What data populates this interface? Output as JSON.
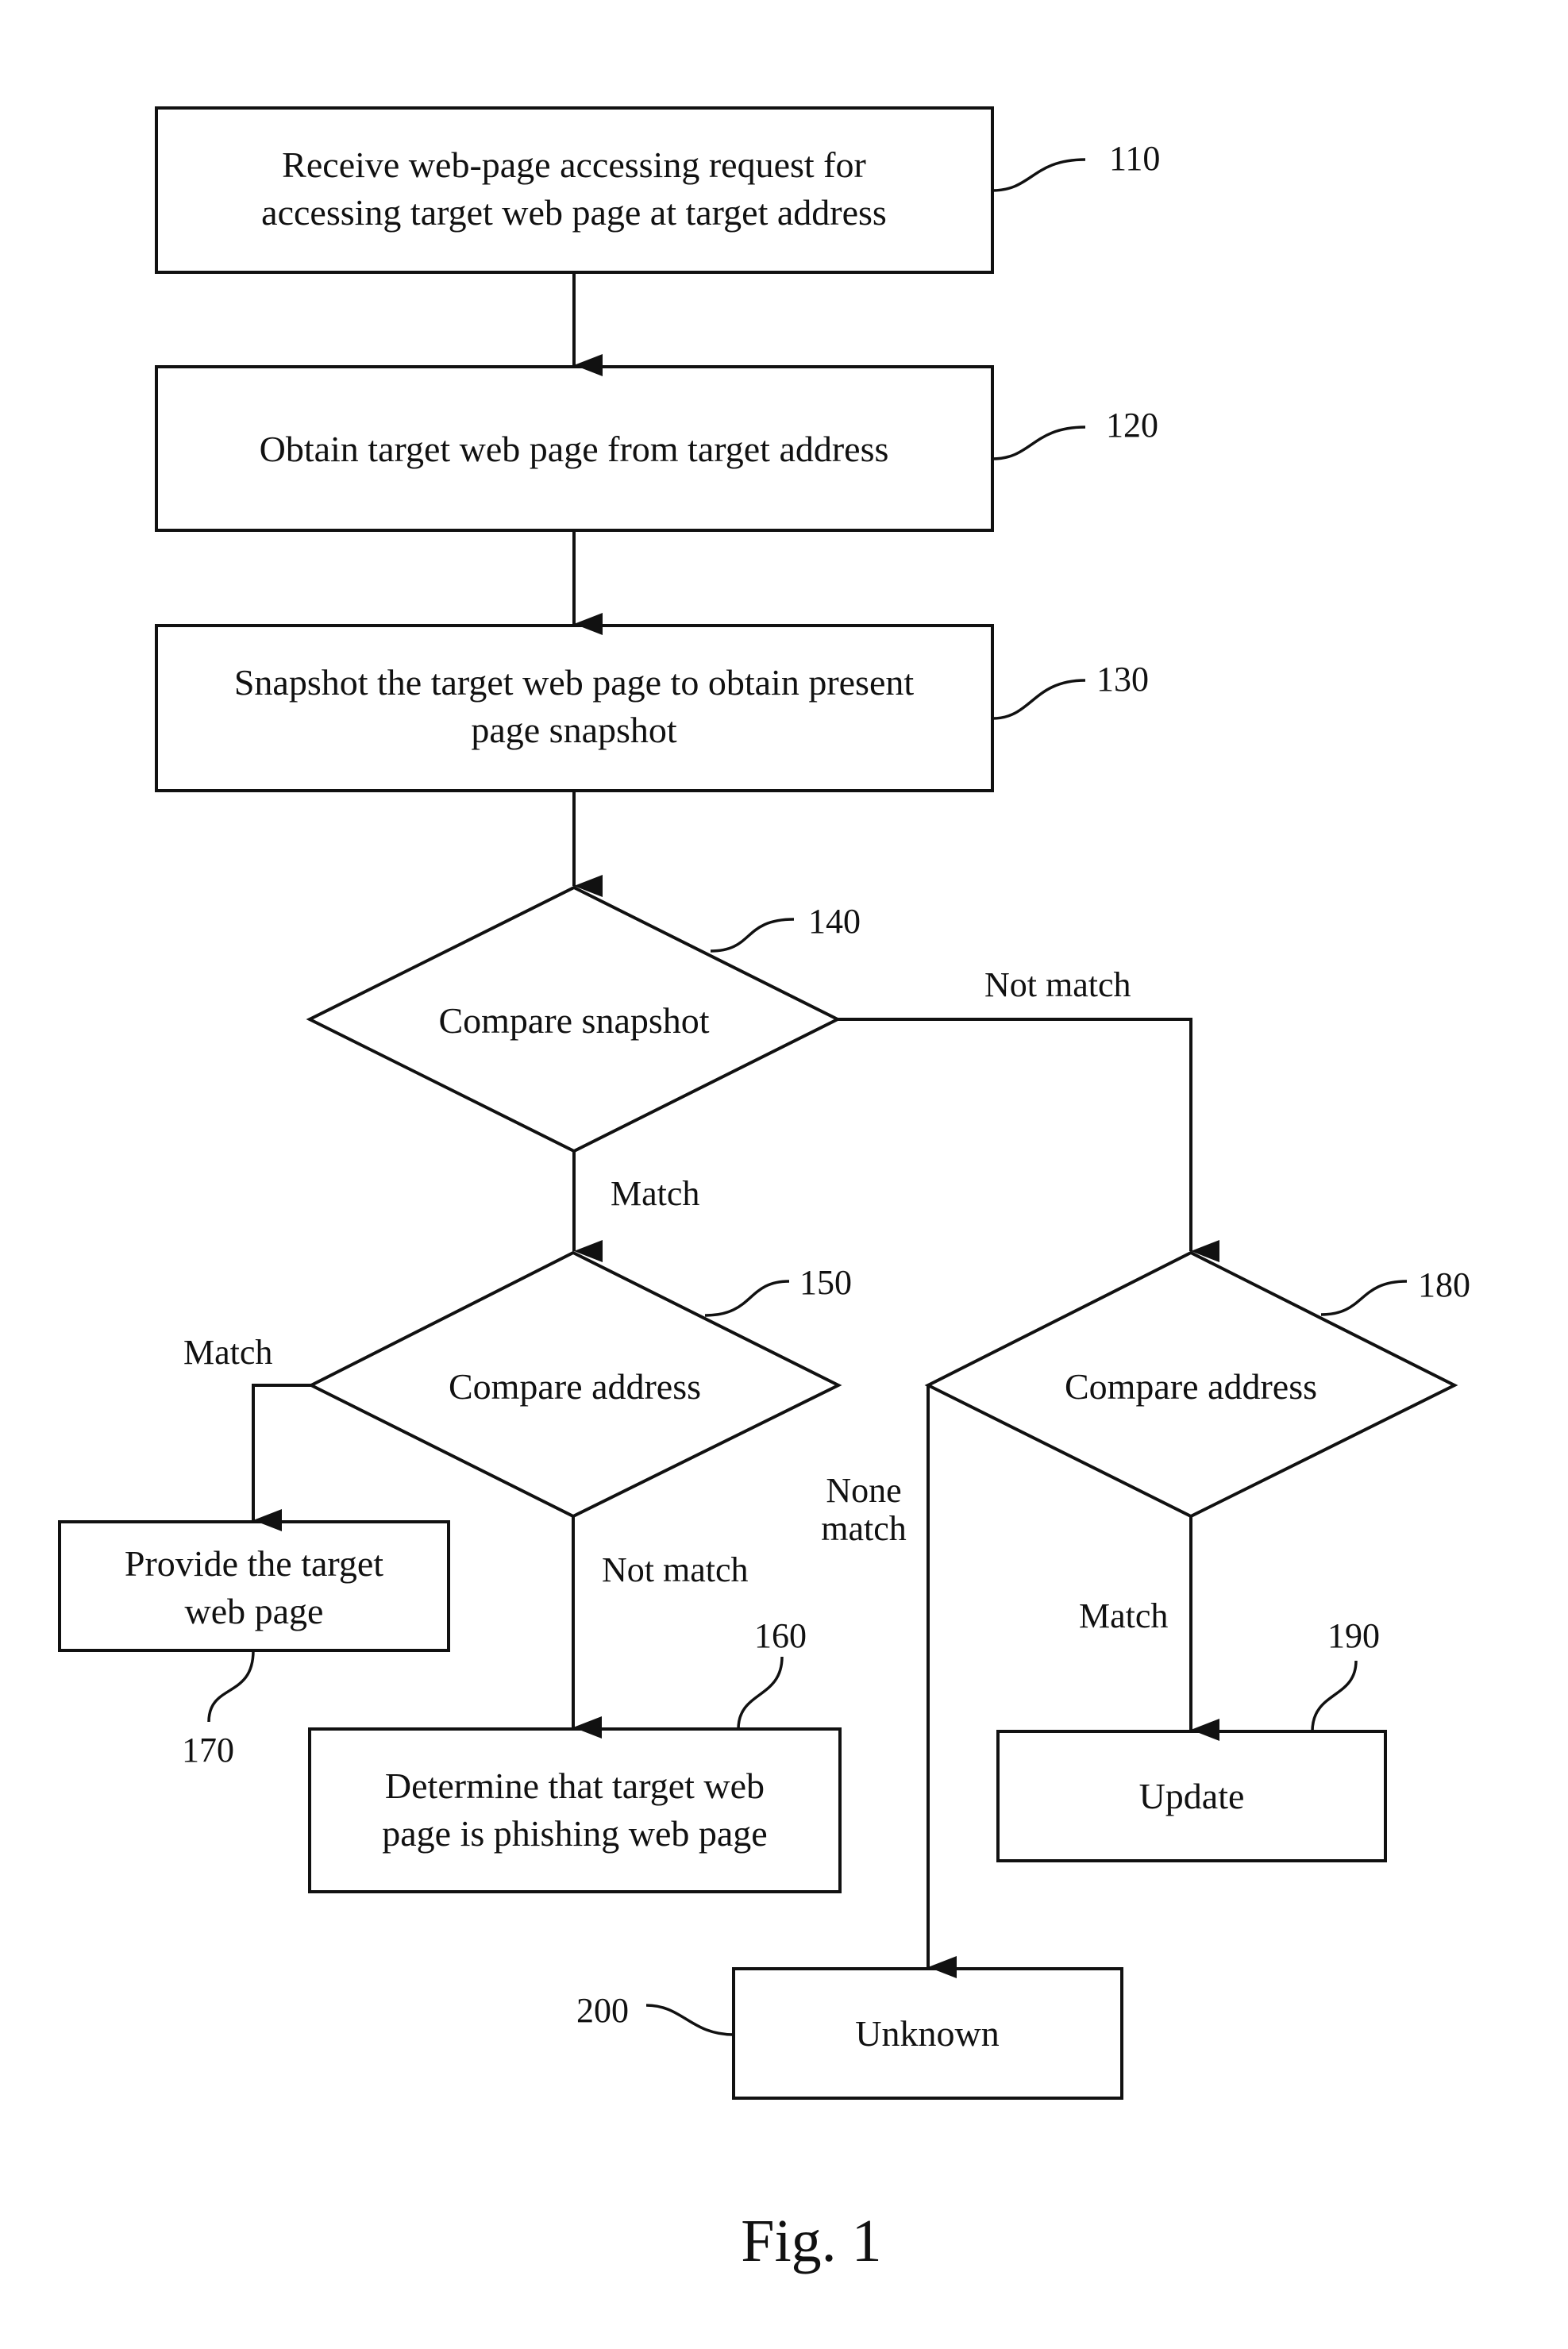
{
  "diagram": {
    "type": "flowchart",
    "caption": "Fig. 1",
    "nodes": [
      {
        "id": "110",
        "shape": "process",
        "ref": "110",
        "lines": [
          "Receive web-page accessing request for",
          "accessing target web page at target address"
        ]
      },
      {
        "id": "120",
        "shape": "process",
        "ref": "120",
        "lines": [
          "Obtain target web page from target address"
        ]
      },
      {
        "id": "130",
        "shape": "process",
        "ref": "130",
        "lines": [
          "Snapshot the target web page to obtain present",
          "page snapshot"
        ]
      },
      {
        "id": "140",
        "shape": "decision",
        "ref": "140",
        "lines": [
          "Compare snapshot"
        ]
      },
      {
        "id": "150",
        "shape": "decision",
        "ref": "150",
        "lines": [
          "Compare address"
        ]
      },
      {
        "id": "180",
        "shape": "decision",
        "ref": "180",
        "lines": [
          "Compare address"
        ]
      },
      {
        "id": "170",
        "shape": "process",
        "ref": "170",
        "lines": [
          "Provide the target",
          "web page"
        ]
      },
      {
        "id": "160",
        "shape": "process",
        "ref": "160",
        "lines": [
          "Determine that target web",
          "page is phishing web page"
        ]
      },
      {
        "id": "190",
        "shape": "process",
        "ref": "190",
        "lines": [
          "Update"
        ]
      },
      {
        "id": "200",
        "shape": "process",
        "ref": "200",
        "lines": [
          "Unknown"
        ]
      }
    ],
    "edges": [
      {
        "from": "110",
        "to": "120",
        "label": ""
      },
      {
        "from": "120",
        "to": "130",
        "label": ""
      },
      {
        "from": "130",
        "to": "140",
        "label": ""
      },
      {
        "from": "140",
        "to": "150",
        "label": "Match"
      },
      {
        "from": "140",
        "to": "180",
        "label": "Not match"
      },
      {
        "from": "150",
        "to": "170",
        "label": "Match"
      },
      {
        "from": "150",
        "to": "160",
        "label": "Not match"
      },
      {
        "from": "180",
        "to": "190",
        "label": "Match"
      },
      {
        "from": "180",
        "to": "200",
        "label": "None match"
      }
    ],
    "edge_label_lines": {
      "none_match": [
        "None",
        "match"
      ]
    }
  }
}
